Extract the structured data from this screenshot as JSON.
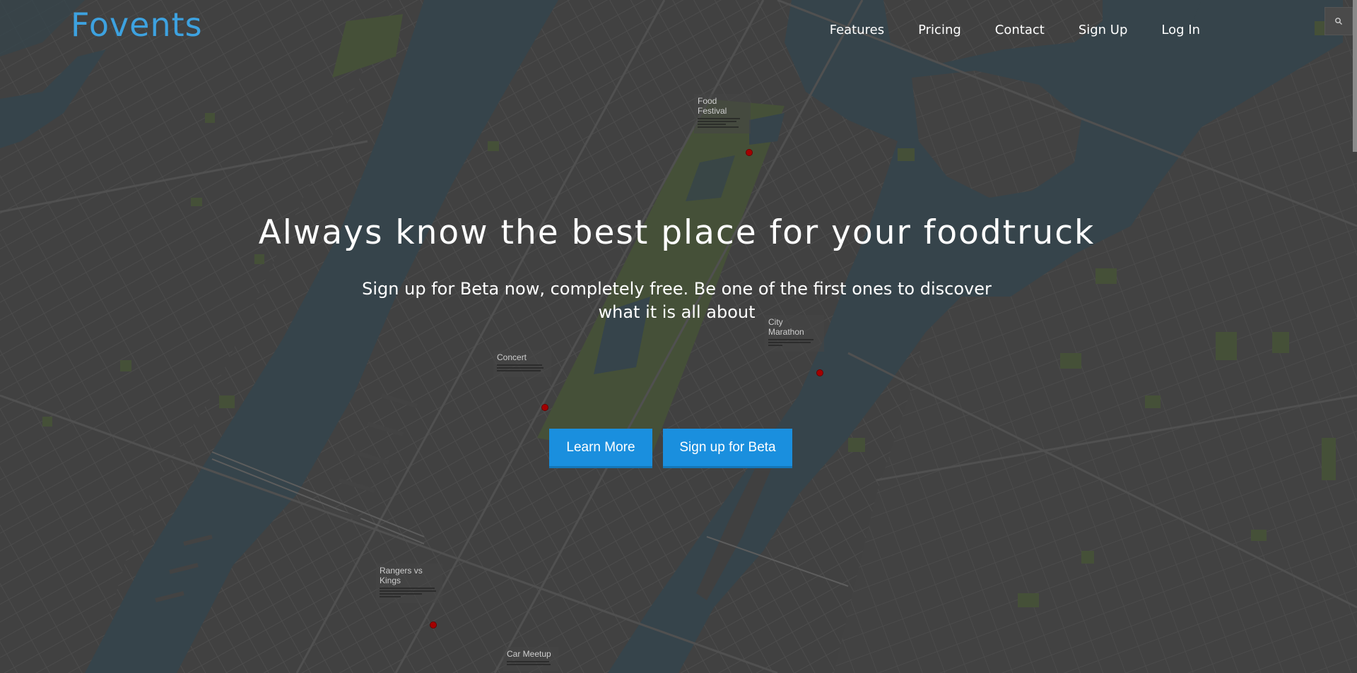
{
  "header": {
    "logo_text": "Fovents",
    "nav": [
      {
        "label": "Features"
      },
      {
        "label": "Pricing"
      },
      {
        "label": "Contact"
      },
      {
        "label": "Sign Up"
      },
      {
        "label": "Log In"
      }
    ],
    "search_icon": "magnifier-icon"
  },
  "hero": {
    "title": "Always know the best place for your foodtruck",
    "subtitle": "Sign up for Beta now, completely free. Be one of the first ones to discover what it is all about",
    "learn_more_label": "Learn More",
    "signup_beta_label": "Sign up for Beta"
  },
  "map": {
    "events": [
      {
        "title": "Food Festival"
      },
      {
        "title": "Concert"
      },
      {
        "title": "City Marathon"
      },
      {
        "title": "Rangers vs Kings"
      },
      {
        "title": "Car Meetup"
      }
    ]
  },
  "colors": {
    "brand": "#3da2e0",
    "button": "#1a8fde",
    "water": "#3b4d55",
    "land": "#4a4a4a",
    "park": "#4c5a3c",
    "pin": "#a40000"
  }
}
